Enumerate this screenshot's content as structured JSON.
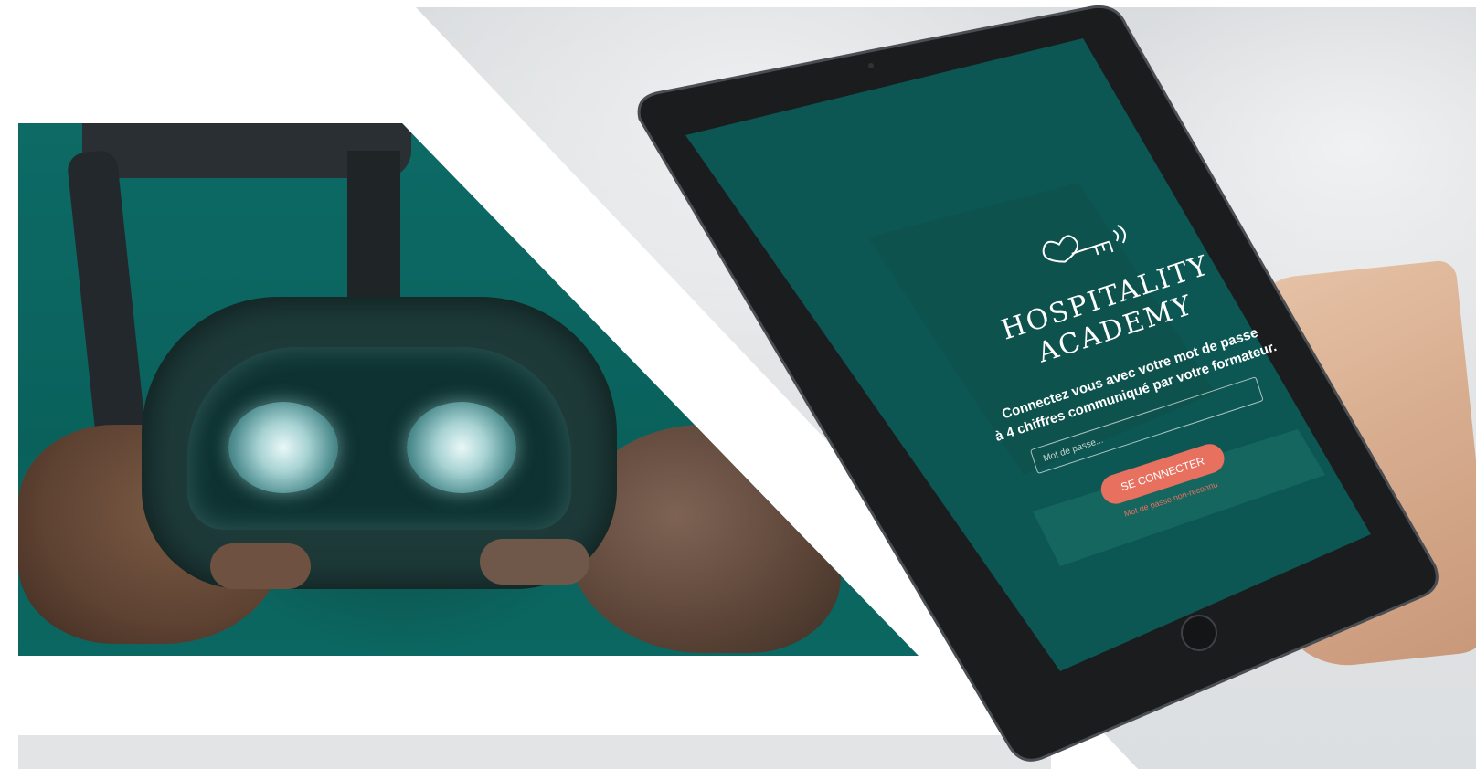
{
  "brand": {
    "line1": "HOSPITALITY",
    "line2": "ACADEMY",
    "logo_icon": "key-with-wireless-icon"
  },
  "login": {
    "instructions_line1": "Connectez vous avec votre mot de passe",
    "instructions_line2": "à 4 chiffres communiqué par votre formateur.",
    "password_placeholder": "Mot de passe...",
    "submit_label": "SE CONNECTER",
    "error_message": "Mot de passe non-reconnu"
  },
  "colors": {
    "teal": "#0b5f5b",
    "accent": "#e8705f",
    "tablet_bezel": "#1a1c1e"
  }
}
